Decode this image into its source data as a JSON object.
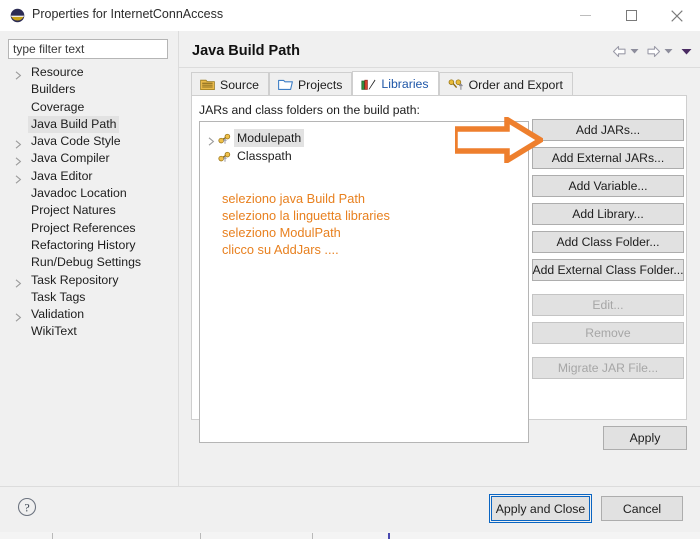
{
  "window": {
    "title": "Properties for InternetConnAccess",
    "icon": "eclipse-logo-icon",
    "controls": {
      "minimize": "—",
      "maximize": "□",
      "close": "✕"
    }
  },
  "filter": {
    "placeholder": "type filter text",
    "value": "type filter text"
  },
  "sidebar": {
    "items": [
      {
        "label": "Resource",
        "expandable": true,
        "selected": false
      },
      {
        "label": "Builders",
        "expandable": false,
        "selected": false
      },
      {
        "label": "Coverage",
        "expandable": false,
        "selected": false
      },
      {
        "label": "Java Build Path",
        "expandable": false,
        "selected": true
      },
      {
        "label": "Java Code Style",
        "expandable": true,
        "selected": false
      },
      {
        "label": "Java Compiler",
        "expandable": true,
        "selected": false
      },
      {
        "label": "Java Editor",
        "expandable": true,
        "selected": false
      },
      {
        "label": "Javadoc Location",
        "expandable": false,
        "selected": false
      },
      {
        "label": "Project Natures",
        "expandable": false,
        "selected": false
      },
      {
        "label": "Project References",
        "expandable": false,
        "selected": false
      },
      {
        "label": "Refactoring History",
        "expandable": false,
        "selected": false
      },
      {
        "label": "Run/Debug Settings",
        "expandable": false,
        "selected": false
      },
      {
        "label": "Task Repository",
        "expandable": true,
        "selected": false
      },
      {
        "label": "Task Tags",
        "expandable": false,
        "selected": false
      },
      {
        "label": "Validation",
        "expandable": true,
        "selected": false
      },
      {
        "label": "WikiText",
        "expandable": false,
        "selected": false
      }
    ]
  },
  "header": {
    "title": "Java Build Path",
    "nav": {
      "back": "back-arrow-icon",
      "back_menu": "chevron-down-icon",
      "forward": "forward-arrow-icon",
      "forward_menu": "chevron-down-icon",
      "view_menu": "view-menu-icon"
    }
  },
  "tabs": [
    {
      "label": "Source",
      "icon": "source-folder-icon",
      "active": false
    },
    {
      "label": "Projects",
      "icon": "project-folder-icon",
      "active": false
    },
    {
      "label": "Libraries",
      "icon": "libraries-icon",
      "active": true
    },
    {
      "label": "Order and Export",
      "icon": "order-export-icon",
      "active": false
    }
  ],
  "main": {
    "panel_label": "JARs and class folders on the build path:",
    "tree_items": [
      {
        "label": "Modulepath",
        "expandable": true,
        "selected": true,
        "icon": "classpath-icon"
      },
      {
        "label": "Classpath",
        "expandable": false,
        "selected": false,
        "icon": "classpath-icon"
      }
    ],
    "notes": [
      "seleziono java Build Path",
      "seleziono la linguetta libraries",
      "seleziono ModulPath",
      "clicco su AddJars ...."
    ],
    "notes_color": "#e8801f"
  },
  "side_buttons": [
    {
      "label": "Add JARs...",
      "enabled": true,
      "gap_before": false
    },
    {
      "label": "Add External JARs...",
      "enabled": true,
      "gap_before": false
    },
    {
      "label": "Add Variable...",
      "enabled": true,
      "gap_before": false
    },
    {
      "label": "Add Library...",
      "enabled": true,
      "gap_before": false
    },
    {
      "label": "Add Class Folder...",
      "enabled": true,
      "gap_before": false
    },
    {
      "label": "Add External Class Folder...",
      "enabled": true,
      "gap_before": false
    },
    {
      "label": "Edit...",
      "enabled": false,
      "gap_before": true
    },
    {
      "label": "Remove",
      "enabled": false,
      "gap_before": false
    },
    {
      "label": "Migrate JAR File...",
      "enabled": false,
      "gap_before": true
    }
  ],
  "apply": {
    "label": "Apply"
  },
  "footer": {
    "help": "help-icon",
    "apply_and_close": "Apply and Close",
    "cancel": "Cancel",
    "focus_color": "#0a65c2"
  },
  "annotation": {
    "arrow": "orange-pointer-arrow",
    "color": "#ee7f2d",
    "points_to": "Add JARs..."
  }
}
